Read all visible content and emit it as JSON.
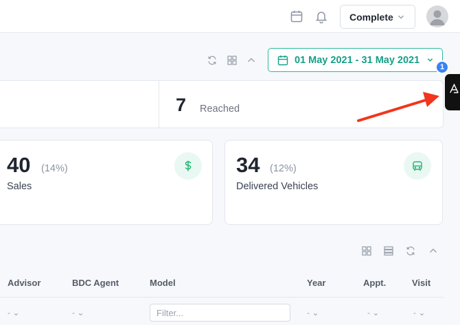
{
  "header": {
    "status_select": "Complete"
  },
  "toolbar": {
    "date_range": "01 May 2021 - 31 May 2021"
  },
  "reach": {
    "count": "7",
    "label": "Reached"
  },
  "kpis": [
    {
      "value": "40",
      "percent": "(14%)",
      "label": "Sales",
      "icon": "dollar-icon"
    },
    {
      "value": "34",
      "percent": "(12%)",
      "label": "Delivered Vehicles",
      "icon": "vehicle-icon"
    }
  ],
  "side_widget": {
    "badge": "1"
  },
  "table": {
    "columns": [
      "Advisor",
      "BDC Agent",
      "Model",
      "Year",
      "Appt.",
      "Visit"
    ],
    "filter_placeholder": "Filter...",
    "dash_filter_value": "- ⌄"
  },
  "colors": {
    "accent": "#16a085",
    "kpi_icon_bg": "#e9f8f2",
    "kpi_icon": "#22b573",
    "badge": "#3b82f6",
    "annotation_arrow": "#f2351c"
  }
}
